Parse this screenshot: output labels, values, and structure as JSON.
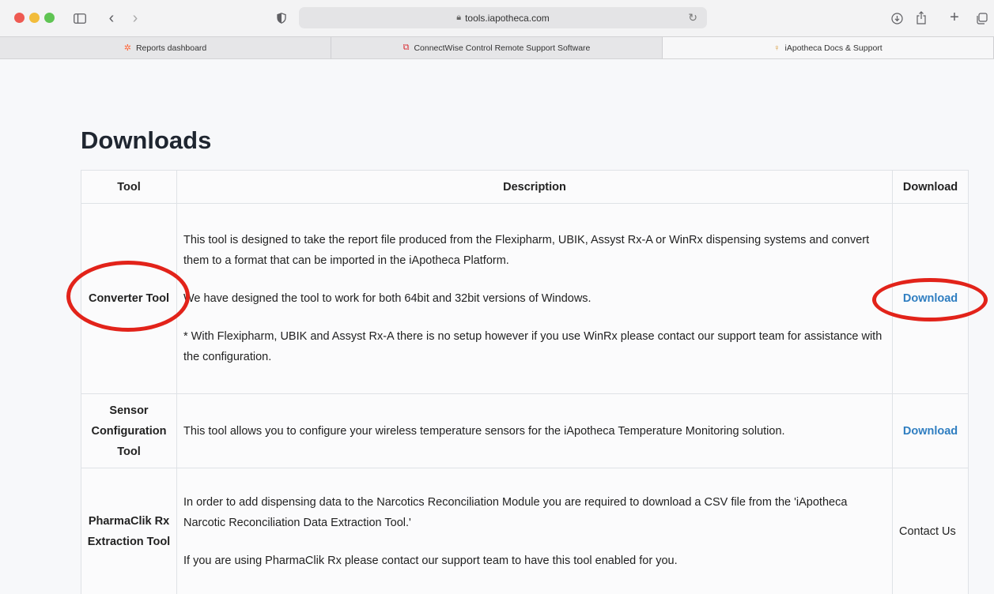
{
  "browser": {
    "url": "tools.iapotheca.com",
    "tabs": [
      {
        "label": "Reports dashboard",
        "icon": "hubspot-icon"
      },
      {
        "label": "ConnectWise Control Remote Support Software",
        "icon": "connectwise-icon"
      },
      {
        "label": "iApotheca Docs & Support",
        "icon": "iapotheca-icon"
      }
    ]
  },
  "page": {
    "heading": "Downloads",
    "table": {
      "headers": [
        "Tool",
        "Description",
        "Download"
      ],
      "rows": [
        {
          "tool": "Converter Tool",
          "description": [
            "This tool is designed to take the report file produced from the Flexipharm, UBIK, Assyst Rx-A or WinRx dispensing systems and convert them to a format that can be imported in the iApotheca Platform.",
            "We have designed the tool to work for both 64bit and 32bit versions of Windows.",
            "* With Flexipharm, UBIK and Assyst Rx-A there is no setup however if you use WinRx please contact our support team for assistance with the configuration."
          ],
          "action": "Download"
        },
        {
          "tool": "Sensor Configuration Tool",
          "description": [
            "This tool allows you to configure your wireless temperature sensors for the iApotheca Temperature Monitoring solution."
          ],
          "action": "Download"
        },
        {
          "tool": "PharmaClik Rx Extraction Tool",
          "description": [
            "In order to add dispensing data to the Narcotics Reconciliation Module you are required to download a CSV file from the 'iApotheca Narcotic Reconciliation Data Extraction Tool.'",
            "If you are using PharmaClik Rx please contact our support team to have this tool enabled for you."
          ],
          "action": "Contact Us"
        }
      ]
    }
  },
  "colors": {
    "link": "#2f7ec1",
    "annotation": "#e2231a"
  }
}
